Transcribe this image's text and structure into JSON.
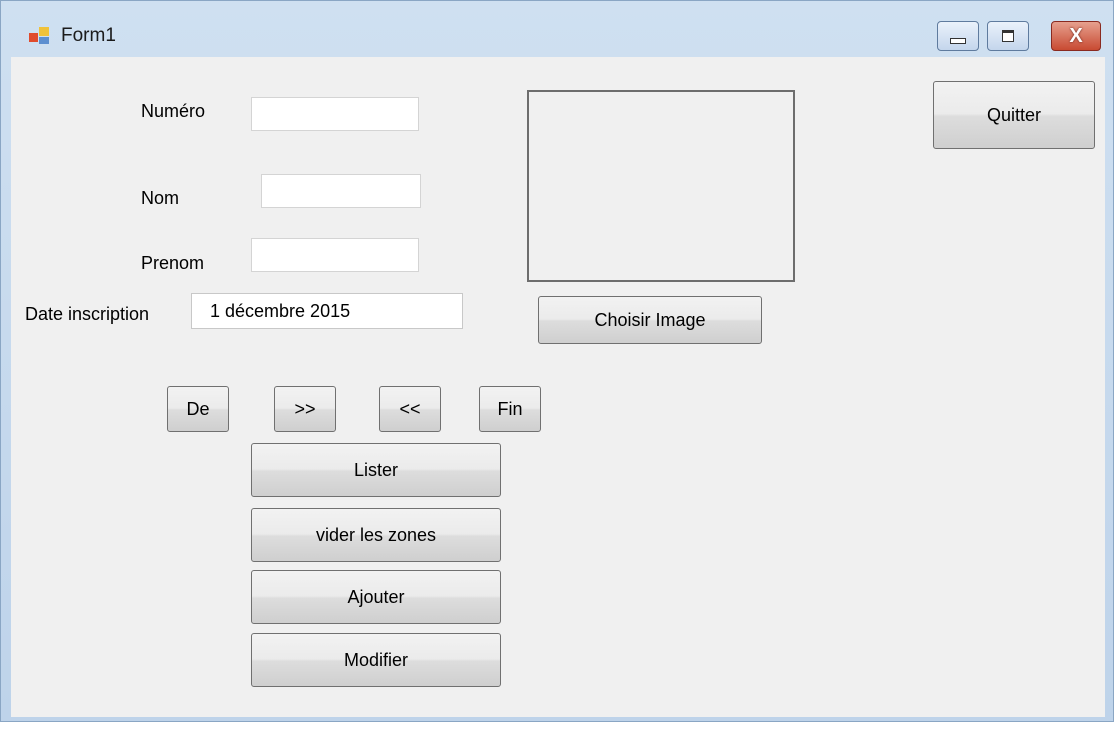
{
  "window": {
    "title": "Form1",
    "colors": {
      "frame": "#bed3ea",
      "client": "#f0f0f0",
      "close": "#c84a32"
    }
  },
  "controls": {
    "minimize_icon": "minimize-icon",
    "maximize_icon": "maximize-icon",
    "close_icon": "close-icon",
    "close_glyph": "X"
  },
  "form": {
    "numero": {
      "label": "Numéro",
      "value": ""
    },
    "nom": {
      "label": "Nom",
      "value": ""
    },
    "prenom": {
      "label": "Prenom",
      "value": ""
    },
    "date_inscription": {
      "label": "Date inscription",
      "value": "1 décembre 2015",
      "icon": "calendar-icon"
    }
  },
  "buttons": {
    "quitter": "Quitter",
    "choisir_image": "Choisir Image",
    "de": "De",
    "next": ">>",
    "prev": "<<",
    "fin": "Fin",
    "lister": "Lister",
    "vider": "vider les zones",
    "ajouter": "Ajouter",
    "modifier": "Modifier"
  }
}
